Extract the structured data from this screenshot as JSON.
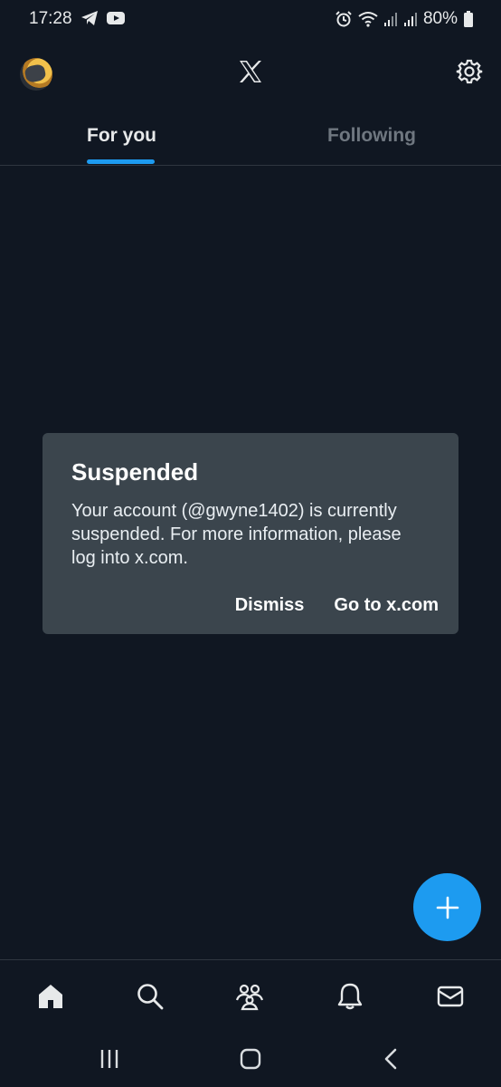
{
  "status_bar": {
    "time": "17:28",
    "battery": "80%",
    "icons": [
      "telegram-icon",
      "youtube-icon",
      "alarm-icon",
      "wifi-icon",
      "signal-icon",
      "signal-icon",
      "battery-icon"
    ]
  },
  "header": {
    "logo": "x-logo-icon",
    "settings_icon": "gear-icon"
  },
  "tabs": [
    {
      "label": "For you",
      "active": true
    },
    {
      "label": "Following",
      "active": false
    }
  ],
  "dialog": {
    "title": "Suspended",
    "body": "Your account (@gwyne1402) is currently suspended. For more information, please log into x.com.",
    "dismiss_label": "Dismiss",
    "goto_label": "Go to x.com"
  },
  "fab": {
    "icon": "plus-icon"
  },
  "bottom_nav": [
    "home-icon",
    "search-icon",
    "communities-icon",
    "notifications-icon",
    "messages-icon"
  ],
  "colors": {
    "background": "#101722",
    "accent": "#1d9bf0",
    "dialog_bg": "#3b454d",
    "inactive_tab": "#6f7780"
  }
}
